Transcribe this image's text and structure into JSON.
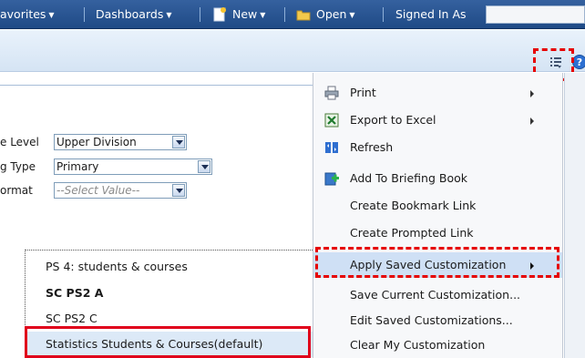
{
  "topnav": {
    "favorites": "avorites",
    "dashboards": "Dashboards",
    "new": "New",
    "open": "Open",
    "signed_in_as": "Signed In As"
  },
  "prompts": [
    {
      "label": "e Level",
      "value": "Upper Division"
    },
    {
      "label": "g Type",
      "value": "Primary"
    },
    {
      "label": "ormat",
      "placeholder": "--Select Value--"
    }
  ],
  "page_menu": {
    "items": [
      {
        "label": "Print",
        "icon": "printer-icon",
        "submenu": true
      },
      {
        "label": "Export to Excel",
        "icon": "excel-icon",
        "submenu": true
      },
      {
        "label": "Refresh",
        "icon": "refresh-icon",
        "submenu": false
      },
      {
        "label": "Add To Briefing Book",
        "icon": "briefing-book-icon",
        "submenu": false
      },
      {
        "label": "Create Bookmark Link",
        "submenu": false
      },
      {
        "label": "Create Prompted Link",
        "submenu": false
      },
      {
        "label": "Apply Saved Customization",
        "submenu": true,
        "active": true
      },
      {
        "label": "Save Current Customization...",
        "submenu": false
      },
      {
        "label": "Edit Saved Customizations...",
        "submenu": false
      },
      {
        "label": "Clear My Customization",
        "submenu": false
      }
    ]
  },
  "saved_customizations": {
    "items": [
      {
        "label": "PS 4: students & courses"
      },
      {
        "label": "SC PS2 A"
      },
      {
        "label": "SC PS2 C"
      },
      {
        "label": "Statistics Students & Courses(default)"
      }
    ]
  },
  "colors": {
    "topbar": "#1f4a86",
    "highlight_red": "#e0001b",
    "menu_active": "#cfe0f5"
  }
}
